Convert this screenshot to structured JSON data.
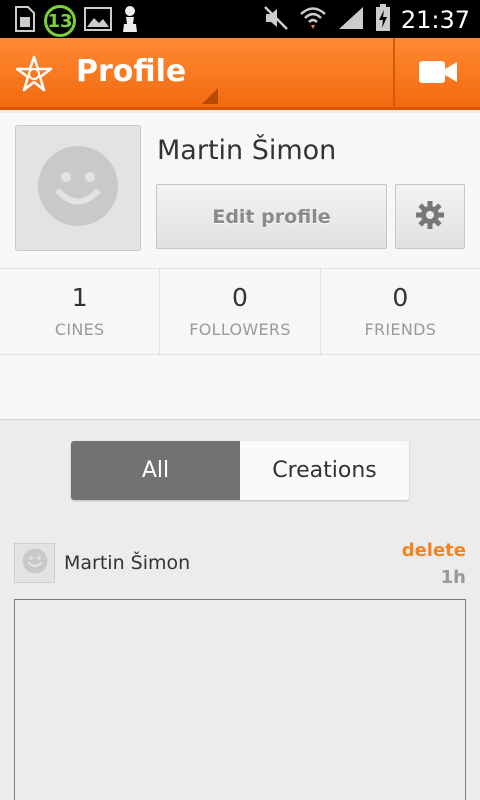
{
  "status_bar": {
    "notification_count": "13",
    "time": "21:37",
    "icons": [
      "sim-icon",
      "image-icon",
      "chess-pawn-icon",
      "mute-icon",
      "wifi-icon",
      "signal-icon",
      "battery-charging-icon"
    ]
  },
  "action_bar": {
    "title": "Profile",
    "logo_icon": "vine-star-logo",
    "video_icon": "video-camera-icon",
    "color": "#f5761a"
  },
  "profile": {
    "name": "Martin Šimon",
    "edit_label": "Edit profile",
    "settings_icon": "gear-icon",
    "stats": [
      {
        "value": "1",
        "label": "CINES"
      },
      {
        "value": "0",
        "label": "FOLLOWERS"
      },
      {
        "value": "0",
        "label": "FRIENDS"
      }
    ]
  },
  "tabs": [
    {
      "label": "All",
      "active": true
    },
    {
      "label": "Creations",
      "active": false
    }
  ],
  "feed": [
    {
      "author": "Martin Šimon",
      "delete_label": "delete",
      "time": "1h"
    }
  ],
  "colors": {
    "accent": "#f5821f",
    "active_tab": "#727272"
  }
}
